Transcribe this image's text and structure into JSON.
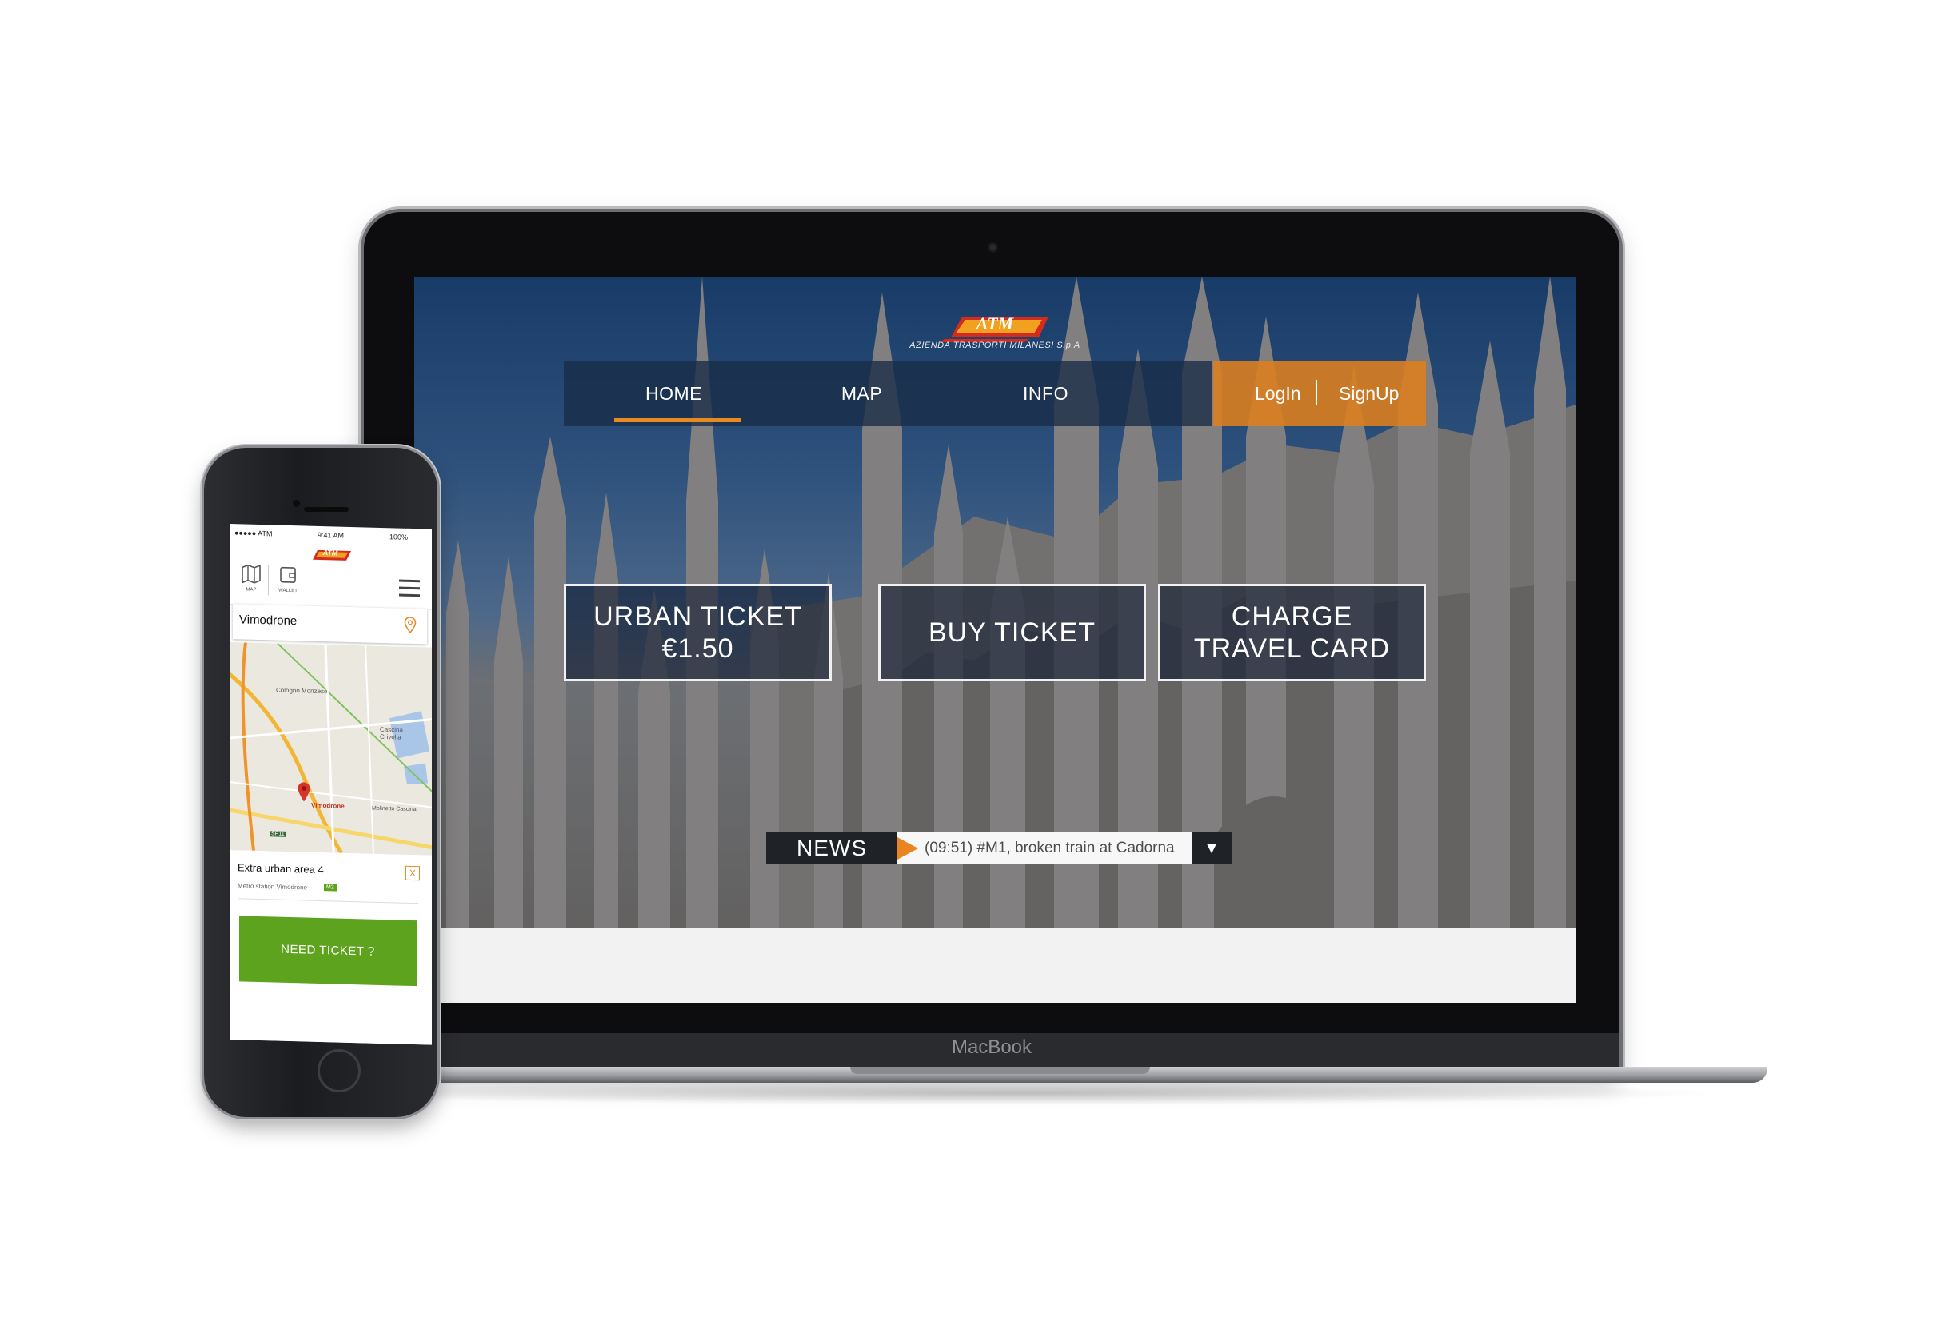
{
  "laptop": {
    "brand": "MacBook",
    "site": {
      "logo": {
        "text": "ATM",
        "tagline": "AZIENDA TRASPORTI MILANESI S.p.A"
      },
      "nav": [
        {
          "label": "HOME",
          "active": true
        },
        {
          "label": "MAP",
          "active": false
        },
        {
          "label": "INFO",
          "active": false
        }
      ],
      "auth": {
        "login": "LogIn",
        "signup": "SignUp"
      },
      "tiles": [
        {
          "line1": "URBAN TICKET",
          "line2": "€1.50"
        },
        {
          "line1": "BUY TICKET",
          "line2": ""
        },
        {
          "line1": "CHARGE",
          "line2": "TRAVEL CARD"
        }
      ],
      "news": {
        "label": "NEWS",
        "text": "(09:51) #M1, broken train at Cadorna",
        "toggle_icon": "▼"
      },
      "colors": {
        "accent": "#e78a22",
        "nav_bg": "#182b46"
      }
    }
  },
  "phone": {
    "status": {
      "carrier": "●●●●● ATM",
      "time": "9:41 AM",
      "battery": "100%"
    },
    "header": {
      "logo": "ATM",
      "tabs": [
        {
          "label": "MAP",
          "icon": "map-icon"
        },
        {
          "label": "WALLET",
          "icon": "wallet-icon"
        }
      ],
      "menu_icon": "hamburger-icon"
    },
    "search": {
      "value": "Vimodrone",
      "icon": "location-pin-icon"
    },
    "map": {
      "labels": [
        "Cologno Monzese",
        "Cascina Crivella",
        "Vimodrone",
        "Molinetto Cascina",
        "SP11"
      ]
    },
    "card": {
      "zone": "Extra urban area 4",
      "station": "Metro station Vimodrone",
      "badge": "M2",
      "close": "X",
      "button": "NEED  TICKET ?"
    },
    "colors": {
      "button": "#5ea31e",
      "pin": "#d9342b"
    }
  }
}
